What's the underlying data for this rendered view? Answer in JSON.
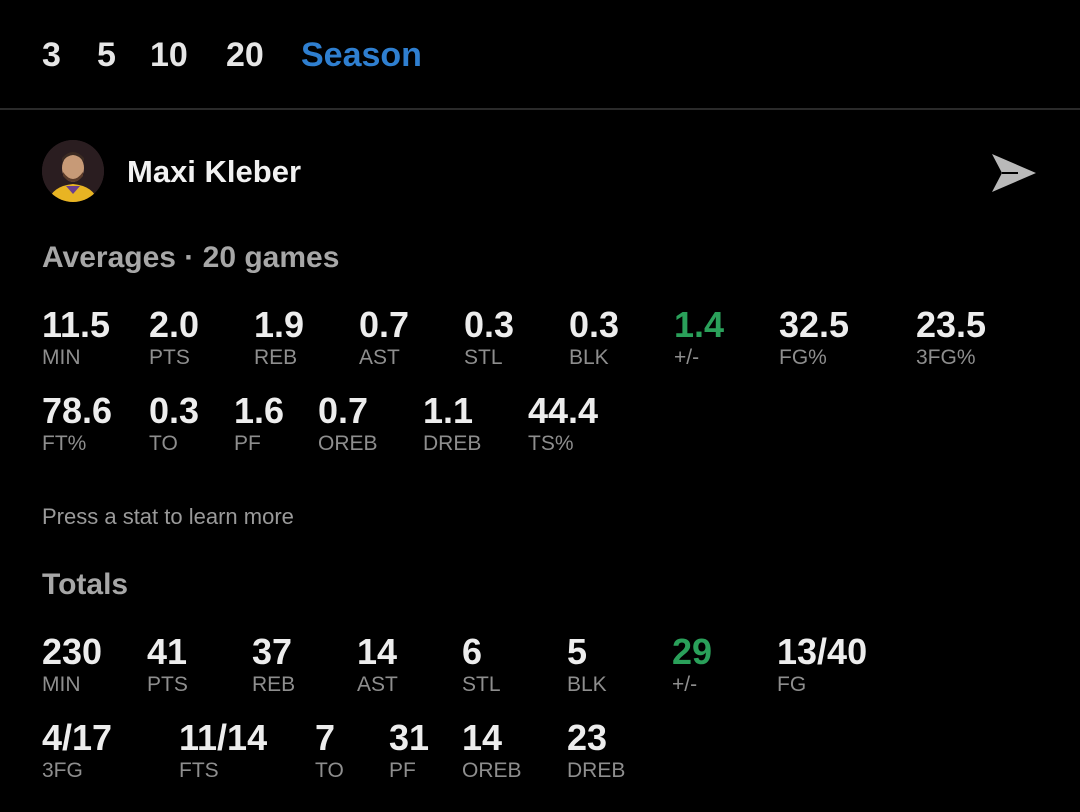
{
  "tabs": [
    "3",
    "5",
    "10",
    "20",
    "Season"
  ],
  "active_tab": "Season",
  "player": {
    "name": "Maxi Kleber"
  },
  "averages": {
    "title": "Averages · 20 games",
    "row1": [
      {
        "value": "11.5",
        "label": "MIN"
      },
      {
        "value": "2.0",
        "label": "PTS"
      },
      {
        "value": "1.9",
        "label": "REB"
      },
      {
        "value": "0.7",
        "label": "AST"
      },
      {
        "value": "0.3",
        "label": "STL"
      },
      {
        "value": "0.3",
        "label": "BLK"
      },
      {
        "value": "1.4",
        "label": "+/-"
      },
      {
        "value": "32.5",
        "label": "FG%"
      },
      {
        "value": "23.5",
        "label": "3FG%"
      }
    ],
    "row2": [
      {
        "value": "78.6",
        "label": "FT%"
      },
      {
        "value": "0.3",
        "label": "TO"
      },
      {
        "value": "1.6",
        "label": "PF"
      },
      {
        "value": "0.7",
        "label": "OREB"
      },
      {
        "value": "1.1",
        "label": "DREB"
      },
      {
        "value": "44.4",
        "label": "TS%"
      }
    ]
  },
  "hint": "Press a stat to learn more",
  "totals": {
    "title": "Totals",
    "row1": [
      {
        "value": "230",
        "label": "MIN"
      },
      {
        "value": "41",
        "label": "PTS"
      },
      {
        "value": "37",
        "label": "REB"
      },
      {
        "value": "14",
        "label": "AST"
      },
      {
        "value": "6",
        "label": "STL"
      },
      {
        "value": "5",
        "label": "BLK"
      },
      {
        "value": "29",
        "label": "+/-"
      },
      {
        "value": "13/40",
        "label": "FG"
      }
    ],
    "row2": [
      {
        "value": "4/17",
        "label": "3FG"
      },
      {
        "value": "11/14",
        "label": "FTS"
      },
      {
        "value": "7",
        "label": "TO"
      },
      {
        "value": "31",
        "label": "PF"
      },
      {
        "value": "14",
        "label": "OREB"
      },
      {
        "value": "23",
        "label": "DREB"
      }
    ]
  },
  "colors": {
    "background": "#000000",
    "active_tab": "#2f7fd0",
    "positive": "#2aa05a",
    "value": "#ededed",
    "label": "#8e8e8e"
  },
  "icons": {
    "share": "send-icon",
    "avatar": "player-avatar"
  }
}
